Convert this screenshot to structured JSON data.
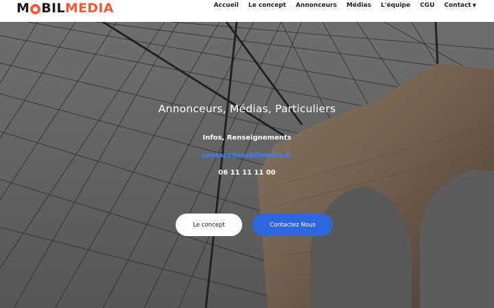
{
  "brand": {
    "logo_part1": "M",
    "logo_part2": "BIL",
    "logo_part3": "MEDIA"
  },
  "nav": {
    "items": [
      {
        "label": "Accueil"
      },
      {
        "label": "Le concept"
      },
      {
        "label": "Annonceurs"
      },
      {
        "label": "Médias"
      },
      {
        "label": "L'équipe"
      },
      {
        "label": "CGU"
      },
      {
        "label": "Contact"
      }
    ]
  },
  "hero": {
    "title": "Annonceurs, Médias, Particuliers",
    "info": "Infos, Renseignements",
    "email": "contact@mobilmedia.fr",
    "phone": "06 11 11 11 00",
    "buttons": {
      "concept": "Le concept",
      "contact": "Contactez Nous"
    }
  },
  "colors": {
    "brand_accent": "#ef5b38",
    "primary_button": "#2f66e0",
    "link": "#3b82f6"
  },
  "icons": {
    "contact_dropdown": "chevron-down-icon"
  }
}
